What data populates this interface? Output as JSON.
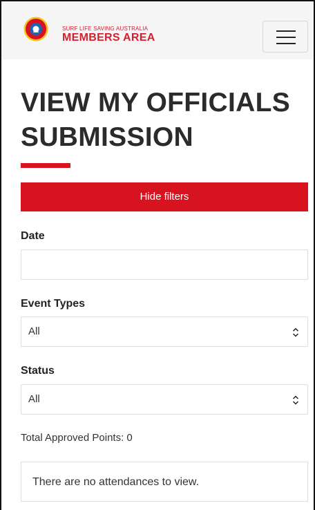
{
  "header": {
    "org_small": "SURF LIFE SAVING AUSTRALIA",
    "org_big": "MEMBERS AREA",
    "logo_icon": "surf-life-saving-logo",
    "menu_icon": "hamburger-icon",
    "brand_color": "#d7131f"
  },
  "page": {
    "title": "VIEW MY OFFICIALS SUBMISSION"
  },
  "filters": {
    "toggle_label": "Hide filters",
    "date_label": "Date",
    "date_value": "",
    "event_types_label": "Event Types",
    "event_types_value": "All",
    "status_label": "Status",
    "status_value": "All"
  },
  "summary": {
    "total_points": "Total Approved Points: 0",
    "empty_message": "There are no attendances to view."
  }
}
